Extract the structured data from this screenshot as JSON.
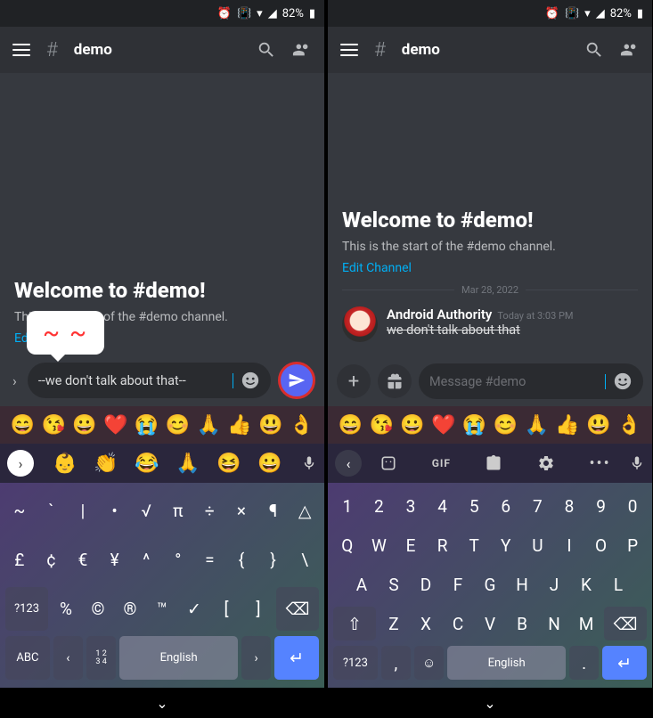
{
  "status": {
    "battery": "82%"
  },
  "header": {
    "channel": "demo"
  },
  "left": {
    "welcome_title": "Welcome to #demo!",
    "welcome_sub": "This is the start of the #demo channel.",
    "edit_link": "Ed",
    "tooltip": "~ ~",
    "input_value": "--we don't talk about that--"
  },
  "right": {
    "welcome_title": "Welcome to #demo!",
    "welcome_sub": "This is the start of the #demo channel.",
    "edit_link": "Edit Channel",
    "date": "Mar 28, 2022",
    "msg": {
      "user": "Android Authority",
      "time": "Today at 3:03 PM",
      "text": "we don't talk about that"
    },
    "placeholder": "Message #demo"
  },
  "emoji_row": [
    "😄",
    "😘",
    "😀",
    "❤️",
    "😭",
    "😊",
    "🙏",
    "👍",
    "😃",
    "👌"
  ],
  "left_toolbar_emoji": [
    "👶",
    "👏",
    "😂",
    "🙏",
    "😆",
    "😀"
  ],
  "kb_left": {
    "r1": [
      "~",
      "`",
      "|",
      "•",
      "√",
      "π",
      "÷",
      "×",
      "¶",
      "△"
    ],
    "r2": [
      "£",
      "¢",
      "€",
      "¥",
      "^",
      "°",
      "=",
      "{",
      "}",
      "\\"
    ],
    "r3": [
      "?123",
      "%",
      "©",
      "®",
      "™",
      "✓",
      "[",
      "]",
      "⌫"
    ],
    "r4_abc": "ABC",
    "r4_fr": "1 2\n3 4",
    "space": "English"
  },
  "kb_right": {
    "r1": [
      "1",
      "2",
      "3",
      "4",
      "5",
      "6",
      "7",
      "8",
      "9",
      "0"
    ],
    "r2": [
      "Q",
      "W",
      "E",
      "R",
      "T",
      "Y",
      "U",
      "I",
      "O",
      "P"
    ],
    "r3": [
      "A",
      "S",
      "D",
      "F",
      "G",
      "H",
      "J",
      "K",
      "L"
    ],
    "r4": [
      "Z",
      "X",
      "C",
      "V",
      "B",
      "N",
      "M"
    ],
    "shift": "⇧",
    "bksp": "⌫",
    "sym": "?123",
    "comma": ",",
    "period": ".",
    "space": "English",
    "gif": "GIF"
  }
}
